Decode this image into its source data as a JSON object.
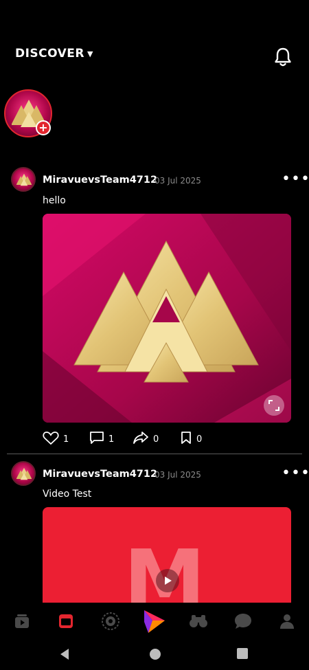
{
  "header": {
    "title": "DISCOVER",
    "title_icon": "caret-down-icon",
    "notification_icon": "bell-icon"
  },
  "story": {
    "add_label": "+"
  },
  "posts": [
    {
      "username": "MiravuevsTeam4712",
      "date": "03 Jul 2025",
      "text": "hello",
      "likes": "1",
      "comments": "1",
      "shares": "0",
      "saves": "0"
    },
    {
      "username": "MiravuevsTeam4712",
      "date": "03 Jul 2025",
      "text": "Video Test",
      "media_letter": "M"
    }
  ],
  "nav": [
    "feed-icon",
    "calendar-icon",
    "stories-icon",
    "play-logo-icon",
    "binoculars-icon",
    "chat-icon",
    "profile-icon"
  ],
  "colors": {
    "accent": "#e3262f",
    "media_pink": "#a3064a",
    "video_red": "#ec1f33",
    "gold": "#e9cf86"
  }
}
